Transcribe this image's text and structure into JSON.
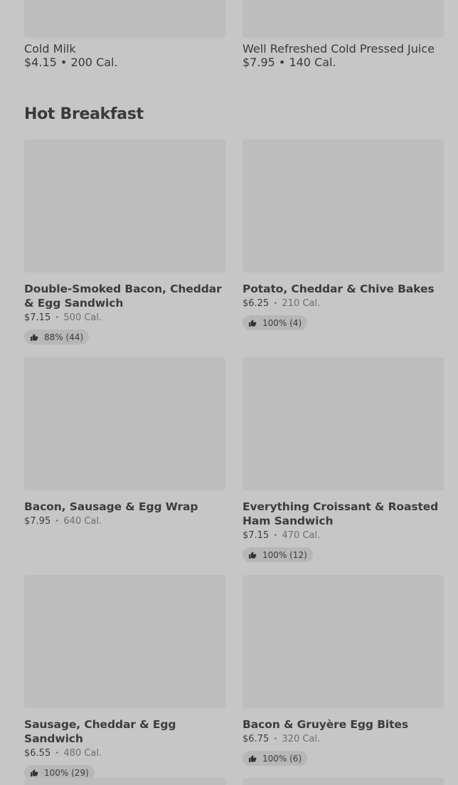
{
  "top_items": [
    {
      "name": "Cold Milk",
      "price": "$4.15",
      "cal": "200 Cal."
    },
    {
      "name": "Well Refreshed Cold Pressed Juice",
      "price": "$7.95",
      "cal": "140 Cal."
    }
  ],
  "section": {
    "title": "Hot Breakfast"
  },
  "items": [
    {
      "name": "Double-Smoked Bacon, Cheddar & Egg Sandwich",
      "price": "$7.15",
      "cal": "500 Cal.",
      "rating": "88% (44)"
    },
    {
      "name": "Potato, Cheddar & Chive Bakes",
      "price": "$6.25",
      "cal": "210 Cal.",
      "rating": "100% (4)"
    },
    {
      "name": "Bacon, Sausage & Egg Wrap",
      "price": "$7.95",
      "cal": "640 Cal.",
      "rating": null
    },
    {
      "name": "Everything Croissant & Roasted Ham Sandwich",
      "price": "$7.15",
      "cal": "470 Cal.",
      "rating": "100% (12)"
    },
    {
      "name": "Sausage, Cheddar & Egg Sandwich",
      "price": "$6.55",
      "cal": "480 Cal.",
      "rating": "100% (29)"
    },
    {
      "name": "Bacon & Gruyère Egg Bites",
      "price": "$6.75",
      "cal": "320 Cal.",
      "rating": "100% (6)"
    }
  ],
  "separator": "•",
  "icons": {
    "rating": "thumbs-up-icon"
  }
}
